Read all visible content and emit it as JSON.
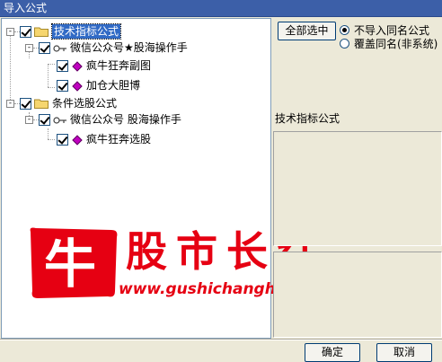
{
  "window": {
    "title": "导入公式"
  },
  "tree": {
    "groups": [
      {
        "label": "技术指标公式",
        "children": [
          {
            "label": "微信公众号★股海操作手",
            "children": [
              {
                "label": "疯牛狂奔副图"
              },
              {
                "label": "加仓大胆博"
              }
            ]
          }
        ]
      },
      {
        "label": "条件选股公式",
        "children": [
          {
            "label": "微信公众号 股海操作手",
            "children": [
              {
                "label": "疯牛狂奔选股"
              }
            ]
          }
        ]
      }
    ]
  },
  "right": {
    "select_all_label": "全部选中",
    "options": [
      {
        "label": "不导入同名公式",
        "selected": true
      },
      {
        "label": "覆盖同名(非系统)",
        "selected": false
      }
    ],
    "info_title": "技术指标公式"
  },
  "watermark": {
    "logo_char": "牛",
    "title": "股市长红",
    "url": "www.gushichanghong.com"
  },
  "footer": {
    "ok_label": "确定",
    "cancel_label": "取消"
  },
  "colors": {
    "titlebar": "#3c5fa8",
    "watermark_red": "#e60012",
    "selection": "#316ac5",
    "diamond": "#c000c0"
  }
}
